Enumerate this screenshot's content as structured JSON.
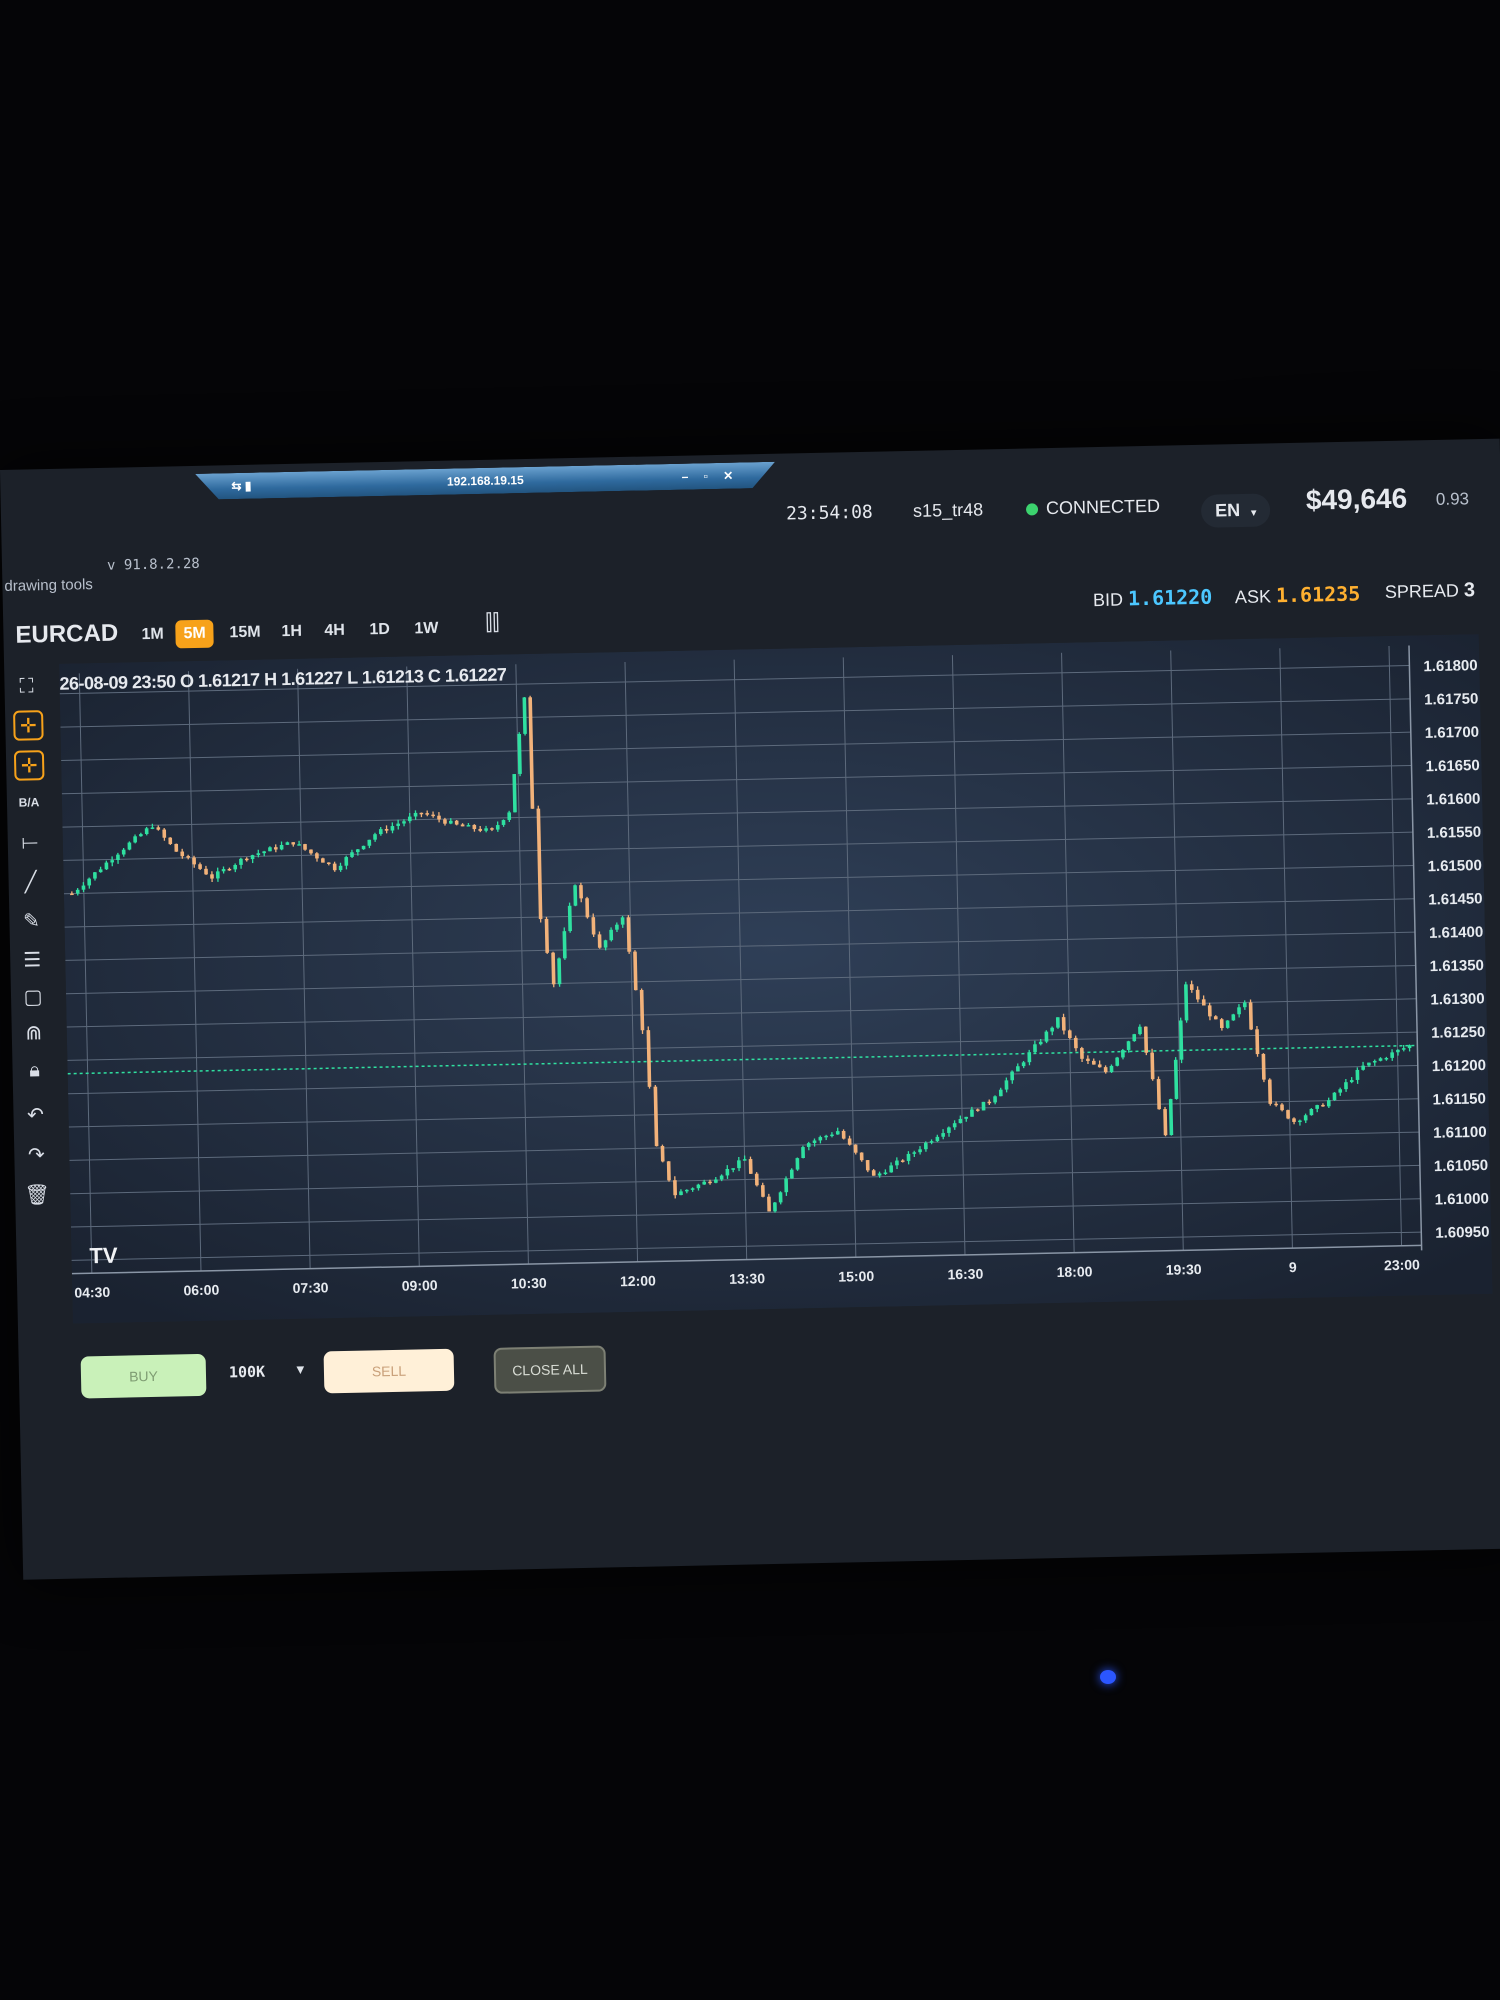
{
  "window": {
    "remote_title": "192.168.19.15",
    "remote_left_icons": "⇆ ▮",
    "remote_right_icons": "– ▫ ✕"
  },
  "app": {
    "version": "v 91.8.2.28",
    "drawing_tools_label": "drawing tools"
  },
  "topbar": {
    "time": "23:54:08",
    "user": "s15_tr48",
    "connection": "CONNECTED",
    "language": "EN",
    "balance": "$49,646",
    "extra_value": "0.93"
  },
  "instrument": {
    "symbol": "EURCAD",
    "timeframes": [
      "1M",
      "5M",
      "15M",
      "1H",
      "4H",
      "1D",
      "1W"
    ],
    "active_timeframe": "5M",
    "bid_label": "BID",
    "bid": "1.61220",
    "ask_label": "ASK",
    "ask": "1.61235",
    "spread_label": "SPREAD",
    "spread": "3"
  },
  "ohlc_line": "26-08-09 23:50 O 1.61217 H 1.61227 L 1.61213 C 1.61227",
  "sidebar_icons": [
    "fullscreen-icon",
    "crosshair-icon",
    "move-icon",
    "bid-ask-icon",
    "horizontal-line-icon",
    "trend-line-icon",
    "pencil-icon",
    "fibonacci-icon",
    "rectangle-icon",
    "magnet-icon",
    "lock-icon",
    "undo-icon",
    "redo-icon",
    "trash-icon"
  ],
  "sidebar_ba_label": "B/A",
  "order_panel": {
    "buy_label": "BUY",
    "lot_size": "100K",
    "sell_label": "SELL",
    "close_all_label": "CLOSE ALL"
  },
  "colors": {
    "up": "#2fe0a0",
    "down": "#f2b27a",
    "accent": "#f7a21a",
    "bid": "#4cc7ff",
    "ask": "#ffb030"
  },
  "chart_data": {
    "type": "candlestick",
    "watermark": "TV",
    "x_tick_labels": [
      "04:30",
      "06:00",
      "07:30",
      "09:00",
      "10:30",
      "12:00",
      "13:30",
      "15:00",
      "16:30",
      "18:00",
      "19:30",
      "9",
      "23:00"
    ],
    "y_tick_labels": [
      "1.61800",
      "1.61750",
      "1.61700",
      "1.61650",
      "1.61600",
      "1.61550",
      "1.61500",
      "1.61450",
      "1.61400",
      "1.61350",
      "1.61300",
      "1.61250",
      "1.61200",
      "1.61150",
      "1.61100",
      "1.61050",
      "1.61000",
      "1.60950"
    ],
    "ylim": [
      1.6093,
      1.6183
    ],
    "current_price_line": 1.6123,
    "price_path": [
      [
        0,
        1.615
      ],
      [
        8,
        1.6156
      ],
      [
        14,
        1.616
      ],
      [
        18,
        1.6156
      ],
      [
        24,
        1.6152
      ],
      [
        30,
        1.6155
      ],
      [
        38,
        1.6157
      ],
      [
        45,
        1.6153
      ],
      [
        52,
        1.6158
      ],
      [
        60,
        1.6161
      ],
      [
        66,
        1.6159
      ],
      [
        72,
        1.6158
      ],
      [
        75,
        1.6161
      ],
      [
        78,
        1.6178
      ],
      [
        80,
        1.6145
      ],
      [
        82,
        1.6135
      ],
      [
        86,
        1.615
      ],
      [
        90,
        1.614
      ],
      [
        94,
        1.6145
      ],
      [
        97,
        1.6128
      ],
      [
        99,
        1.611
      ],
      [
        102,
        1.6103
      ],
      [
        108,
        1.6105
      ],
      [
        114,
        1.6108
      ],
      [
        118,
        1.61
      ],
      [
        124,
        1.611
      ],
      [
        130,
        1.6112
      ],
      [
        136,
        1.6105
      ],
      [
        142,
        1.6108
      ],
      [
        150,
        1.6113
      ],
      [
        156,
        1.6116
      ],
      [
        162,
        1.6122
      ],
      [
        168,
        1.6128
      ],
      [
        172,
        1.6122
      ],
      [
        176,
        1.612
      ],
      [
        182,
        1.6127
      ],
      [
        186,
        1.611
      ],
      [
        190,
        1.6133
      ],
      [
        196,
        1.6126
      ],
      [
        200,
        1.613
      ],
      [
        204,
        1.6115
      ],
      [
        208,
        1.6112
      ],
      [
        214,
        1.6115
      ],
      [
        220,
        1.612
      ],
      [
        228,
        1.6123
      ]
    ]
  }
}
